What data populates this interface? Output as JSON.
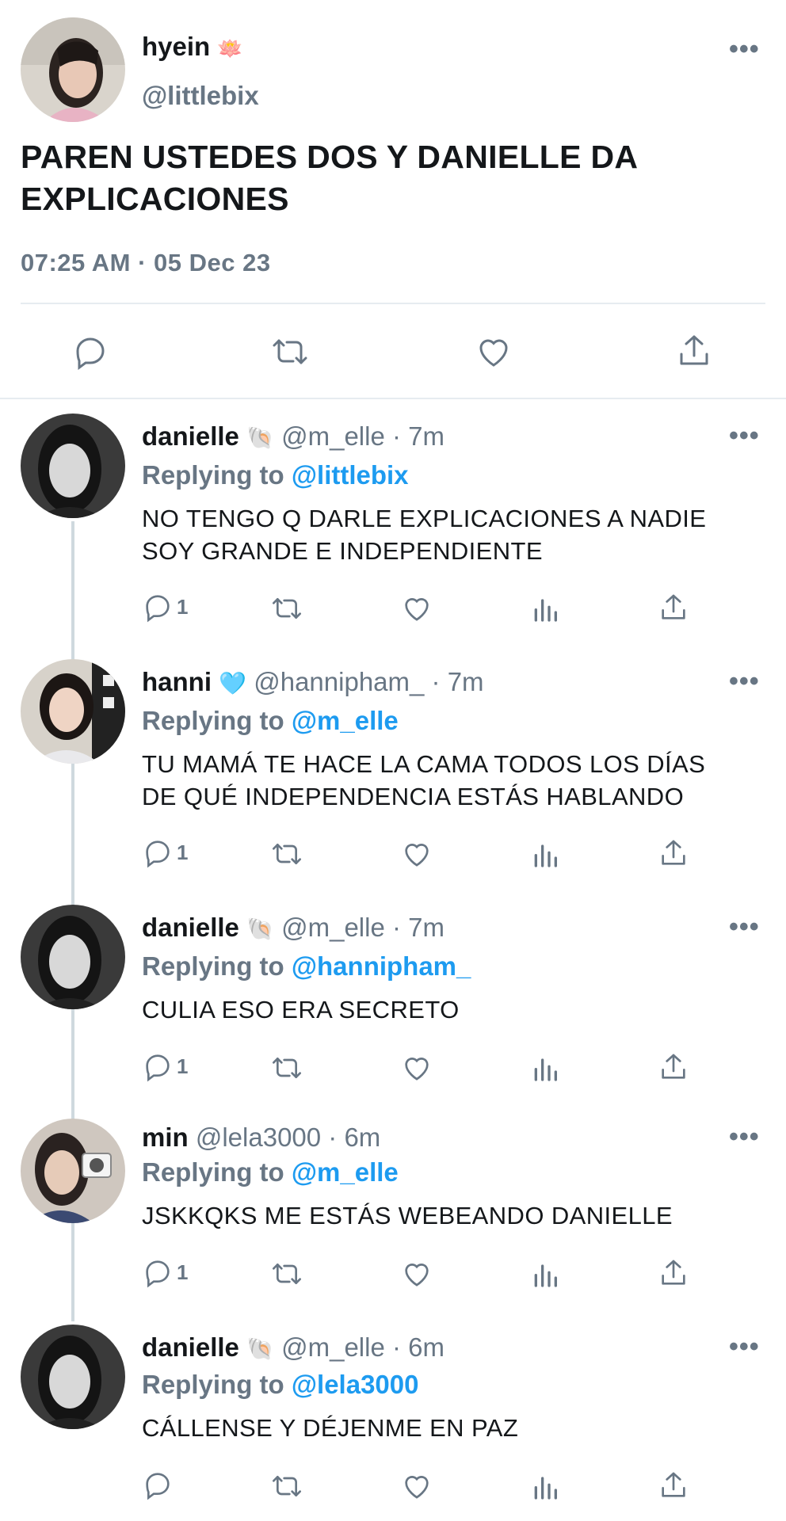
{
  "main_tweet": {
    "name": "hyein",
    "name_emoji": "🪷",
    "handle": "@littlebix",
    "text_line1": "PAREN USTEDES DOS Y DANIELLE DA",
    "text_line2": "EXPLICACIONES",
    "timestamp": "07:25 AM · 05 Dec 23",
    "more_label": "•••"
  },
  "replies": [
    {
      "name": "danielle",
      "emoji": "🐚",
      "meta": "@m_elle · 7m",
      "replying_prefix": "Replying to",
      "replying_to": "@littlebix",
      "line1": "NO TENGO Q DARLE EXPLICACIONES A NADIE",
      "line2": "SOY GRANDE E INDEPENDIENTE",
      "reply_count": "1",
      "more_label": "•••"
    },
    {
      "name": "hanni",
      "emoji": "🩵",
      "meta": "@hannipham_ · 7m",
      "replying_prefix": "Replying to",
      "replying_to": "@m_elle",
      "line1": "TU MAMÁ TE HACE LA CAMA TODOS LOS DÍAS",
      "line2": "DE QUÉ INDEPENDENCIA ESTÁS HABLANDO",
      "reply_count": "1",
      "more_label": "•••"
    },
    {
      "name": "danielle",
      "emoji": "🐚",
      "meta": "@m_elle · 7m",
      "replying_prefix": "Replying to",
      "replying_to": "@hannipham_",
      "line1": "CULIA ESO ERA SECRETO",
      "line2": "",
      "reply_count": "1",
      "more_label": "•••"
    },
    {
      "name": "min",
      "emoji": "",
      "meta": "@lela3000 · 6m",
      "replying_prefix": "Replying to",
      "replying_to": "@m_elle",
      "line1": "JSKKQKS ME ESTÁS WEBEANDO DANIELLE",
      "line2": "",
      "reply_count": "1",
      "more_label": "•••"
    },
    {
      "name": "danielle",
      "emoji": "🐚",
      "meta": "@m_elle · 6m",
      "replying_prefix": "Replying to",
      "replying_to": "@lela3000",
      "line1": "CÁLLENSE Y DÉJENME EN PAZ",
      "line2": "",
      "reply_count": "",
      "more_label": "•••"
    }
  ],
  "colors": {
    "text": "#14171a",
    "secondary": "#687684",
    "link": "#1d9bf0",
    "divider": "#e6ecf0"
  }
}
